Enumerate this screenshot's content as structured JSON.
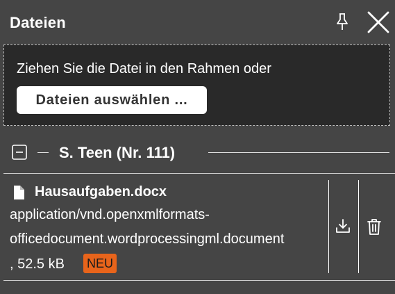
{
  "panel": {
    "title": "Dateien"
  },
  "header": {
    "pin_icon": "pin-icon",
    "close_icon": "close-icon"
  },
  "dropzone": {
    "text": "Ziehen Sie die Datei in den Rahmen oder",
    "button_label": "Dateien auswählen ..."
  },
  "group": {
    "name": "S. Teen (Nr. 111)",
    "collapse_icon": "minus-square-icon"
  },
  "files": [
    {
      "name": "Hausaufgaben.docx",
      "mime_line1": "application/vnd.openxmlformats-",
      "mime_line2": "officedocument.wordprocessingml.document",
      "size": ", 52.5 kB",
      "badge": "NEU",
      "badge_color": "#e8641b"
    }
  ],
  "colors": {
    "background": "#454545",
    "dropzone": "#292929",
    "accent": "#e8641b"
  }
}
